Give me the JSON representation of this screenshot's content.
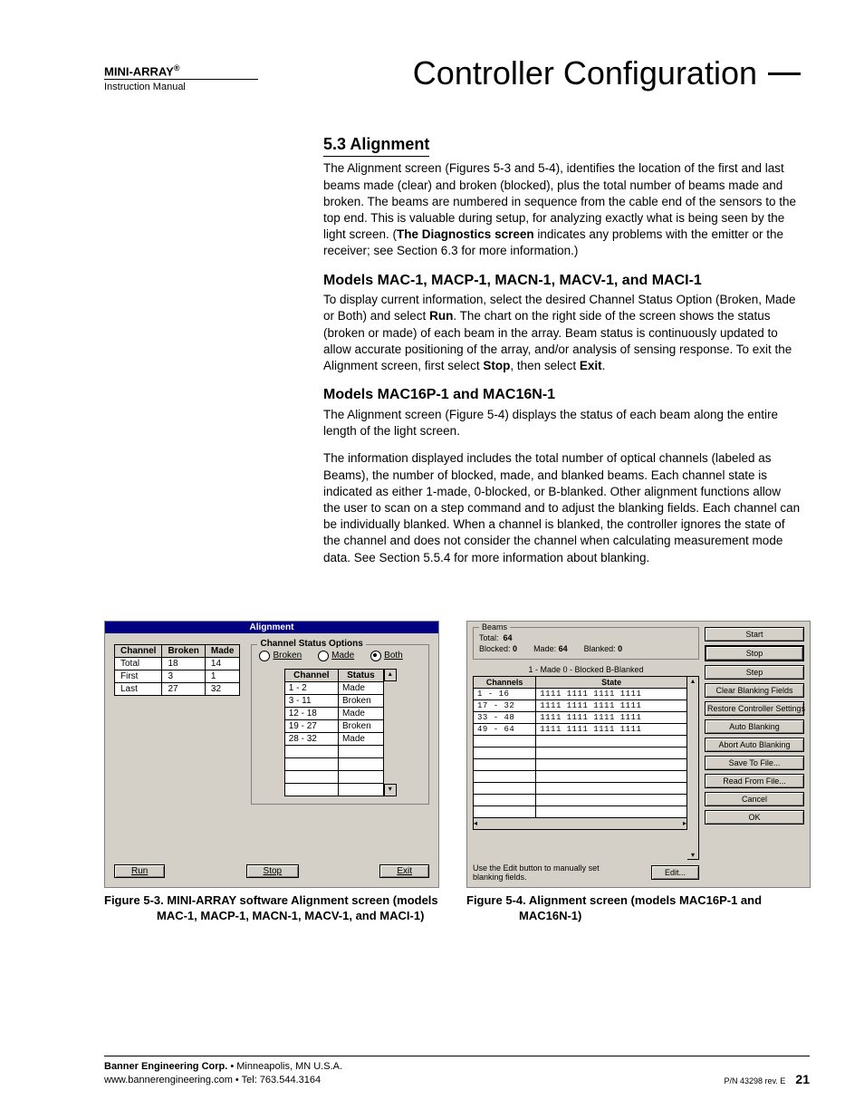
{
  "header": {
    "product": "MINI-ARRAY",
    "reg": "®",
    "subtitle": "Instruction Manual",
    "doc_title": "Controller Configuration"
  },
  "section": {
    "number_title": "5.3  Alignment",
    "para1a": "The Alignment screen (Figures 5-3 and 5-4), identifies the location of the first and last beams made (clear) and broken (blocked), plus the total number of beams made and broken. The beams are numbered in sequence from the cable end of the sensors to the top end. This is valuable during setup, for analyzing exactly what is being seen by the light screen. (",
    "para1_bold": "The Diagnostics screen",
    "para1b": " indicates any problems with the emitter or the receiver; see Section 6.3 for more information.)",
    "sub1": "Models MAC-1, MACP-1, MACN-1, MACV-1, and MACI-1",
    "para2a": "To display current information, select the desired Channel Status Option (Broken, Made or Both) and select ",
    "para2_bold1": "Run",
    "para2b": ". The chart on the right side of the screen shows the status (broken or made) of each beam in the array. Beam status is continuously updated to allow accurate positioning of the array, and/or analysis of sensing response. To exit the Alignment screen, first select ",
    "para2_bold2": "Stop",
    "para2c": ", then select ",
    "para2_bold3": "Exit",
    "para2d": ".",
    "sub2": "Models MAC16P-1 and MAC16N-1",
    "para3": "The Alignment screen (Figure 5-4) displays the status of each beam along the entire length of the light screen.",
    "para4": "The information displayed includes the total number of optical channels (labeled as Beams), the number of blocked, made, and blanked beams. Each channel state is indicated as either 1-made, 0-blocked, or B-blanked. Other alignment functions allow the user to scan on a step command and to adjust the blanking fields. Each channel can be individually blanked. When a channel is blanked, the controller ignores the state of the channel and does not consider the channel when calculating measurement mode data. See Section 5.5.4 for more information about blanking."
  },
  "fig53": {
    "title": "Alignment",
    "channel_hdr": [
      "Channel",
      "Broken",
      "Made"
    ],
    "channel_rows": [
      [
        "Total",
        "18",
        "14"
      ],
      [
        "First",
        "3",
        "1"
      ],
      [
        "Last",
        "27",
        "32"
      ]
    ],
    "cso_legend": "Channel Status Options",
    "opt_broken": "Broken",
    "opt_made": "Made",
    "opt_both": "Both",
    "status_hdr": [
      "Channel",
      "Status"
    ],
    "status_rows": [
      [
        "1 - 2",
        "Made"
      ],
      [
        "3 - 11",
        "Broken"
      ],
      [
        "12 - 18",
        "Made"
      ],
      [
        "19 - 27",
        "Broken"
      ],
      [
        "28 - 32",
        "Made"
      ]
    ],
    "btn_run": "Run",
    "btn_stop": "Stop",
    "btn_exit": "Exit",
    "caption_a": "Figure 5-3.  MINI-ARRAY software Alignment screen (models",
    "caption_b": "MAC-1, MACP-1, MACN-1, MACV-1, and MACI-1)"
  },
  "fig54": {
    "beams_legend": "Beams",
    "total_label": "Total:",
    "total_val": "64",
    "blocked_label": "Blocked:",
    "blocked_val": "0",
    "made_label": "Made:",
    "made_val": "64",
    "blanked_label": "Blanked:",
    "blanked_val": "0",
    "legend_row": "1 - Made     0 - Blocked     B-Blanked",
    "state_hdr": [
      "Channels",
      "State"
    ],
    "state_rows": [
      [
        "1  - 16",
        "1111 1111 1111 1111"
      ],
      [
        "17 - 32",
        "1111 1111 1111 1111"
      ],
      [
        "33 - 48",
        "1111 1111 1111 1111"
      ],
      [
        "49 - 64",
        "1111 1111 1111 1111"
      ]
    ],
    "hint": "Use the Edit button to manually set blanking fields.",
    "btn_edit": "Edit...",
    "buttons": [
      "Start",
      "Stop",
      "Step",
      "Clear Blanking Fields",
      "Restore Controller Settings",
      "Auto Blanking",
      "Abort Auto Blanking",
      "Save To File...",
      "Read From File...",
      "Cancel",
      "OK"
    ],
    "caption_a": "Figure 5-4.  Alignment screen (models MAC16P-1 and",
    "caption_b": "MAC16N-1)"
  },
  "footer": {
    "line1a": "Banner Engineering Corp.",
    "line1b": " • Minneapolis, MN U.S.A.",
    "line2": "www.bannerengineering.com  •  Tel: 763.544.3164",
    "pn": "P/N 43298 rev. E",
    "page": "21"
  }
}
